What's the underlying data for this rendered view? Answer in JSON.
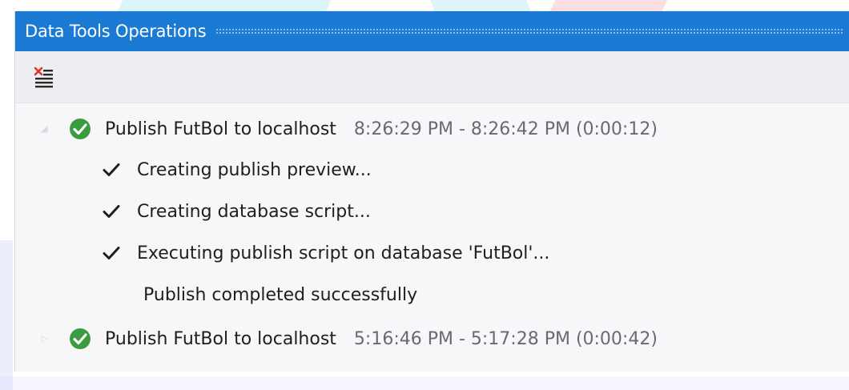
{
  "window": {
    "title": "Data Tools Operations"
  },
  "toolbar": {
    "clear_icon": "clear-list-icon"
  },
  "operations": [
    {
      "title": "Publish FutBol to localhost",
      "time": "8:26:29 PM - 8:26:42 PM (0:00:12)",
      "status_icon": "success-check-circle-icon",
      "status_color": "#3a9b3f",
      "steps": [
        "Creating publish preview...",
        "Creating database script...",
        "Executing publish script on database 'FutBol'..."
      ],
      "message": "Publish completed successfully"
    },
    {
      "title": "Publish FutBol to localhost",
      "time": "5:16:46 PM - 5:17:28 PM (0:00:42)",
      "status_icon": "success-check-circle-icon",
      "status_color": "#3a9b3f"
    }
  ],
  "colors": {
    "titlebar": "#1b7ad4",
    "success": "#3a9b3f",
    "text": "#1e1e1e",
    "time_text": "#666b72",
    "clear_icon_red": "#d93636"
  }
}
